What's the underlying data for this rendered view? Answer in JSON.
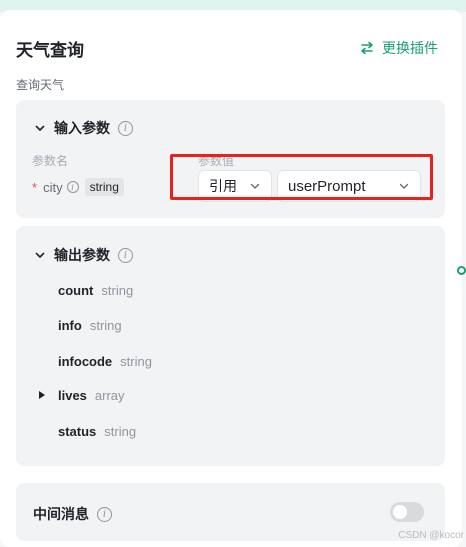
{
  "node": {
    "title": "天气查询",
    "subtitle": "查询天气",
    "switch_plugin_label": "更换插件",
    "accent_color": "#1aa06d"
  },
  "input_params": {
    "heading": "输入参数",
    "col_name": "参数名",
    "col_value": "参数值",
    "rows": [
      {
        "required_mark": "*",
        "name": "city",
        "type": "string",
        "ref_mode": "引用",
        "value": "userPrompt"
      }
    ]
  },
  "output_params": {
    "heading": "输出参数",
    "items": [
      {
        "name": "count",
        "type": "string"
      },
      {
        "name": "info",
        "type": "string"
      },
      {
        "name": "infocode",
        "type": "string"
      },
      {
        "name": "lives",
        "type": "array"
      },
      {
        "name": "status",
        "type": "string"
      }
    ]
  },
  "intermediate_message": {
    "label": "中间消息",
    "enabled": false
  },
  "info_glyph": "i",
  "watermark": "CSDN @kocor",
  "highlight_color": "#e8221b"
}
